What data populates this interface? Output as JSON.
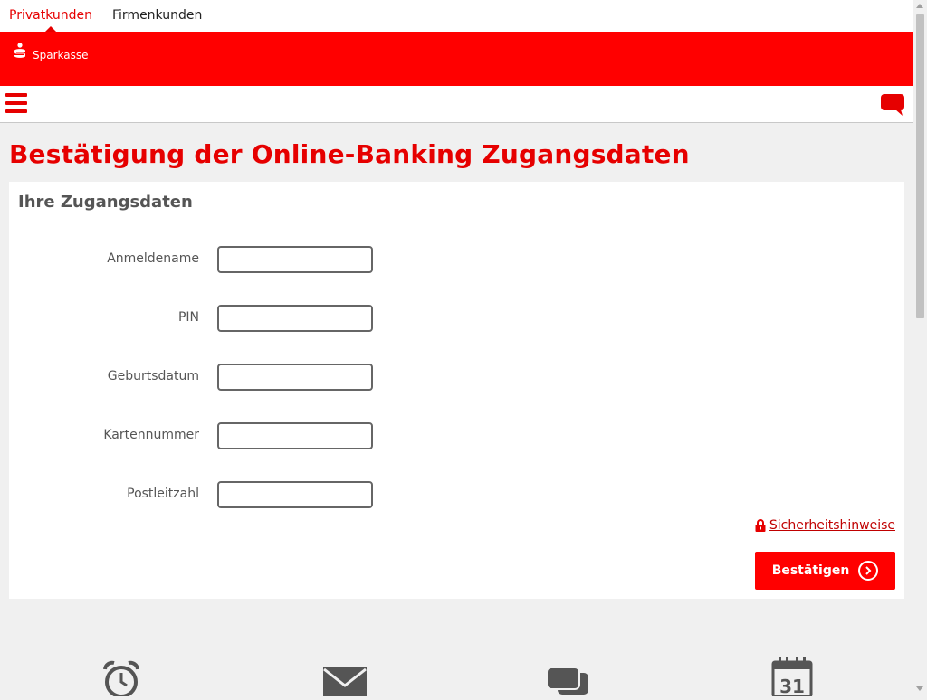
{
  "top_tabs": [
    {
      "label": "Privatkunden",
      "active": true
    },
    {
      "label": "Firmenkunden",
      "active": false
    }
  ],
  "brand": {
    "name": "Sparkasse",
    "color": "#ff0000"
  },
  "nav": {
    "menu_icon": "hamburger-icon",
    "chat_icon": "chat-bubble-icon"
  },
  "page_title": "Bestätigung der Online-Banking Zugangsdaten",
  "panel": {
    "title": "Ihre Zugangsdaten",
    "fields": [
      {
        "label": "Anmeldename",
        "value": "",
        "placeholder": ""
      },
      {
        "label": "PIN",
        "value": "",
        "placeholder": ""
      },
      {
        "label": "Geburtsdatum",
        "value": "",
        "placeholder": ""
      },
      {
        "label": "Kartennummer",
        "value": "",
        "placeholder": ""
      },
      {
        "label": "Postleitzahl",
        "value": "",
        "placeholder": ""
      }
    ],
    "security_link": "Sicherheitshinweise",
    "confirm_button": "Bestätigen"
  },
  "bottom_icons": [
    {
      "name": "alarm-clock-icon"
    },
    {
      "name": "envelope-icon"
    },
    {
      "name": "chat-bubbles-icon"
    },
    {
      "name": "calendar-icon",
      "text": "31"
    }
  ],
  "colors": {
    "accent": "#e60000",
    "text_gray": "#555555",
    "background": "#f0f0f0"
  }
}
